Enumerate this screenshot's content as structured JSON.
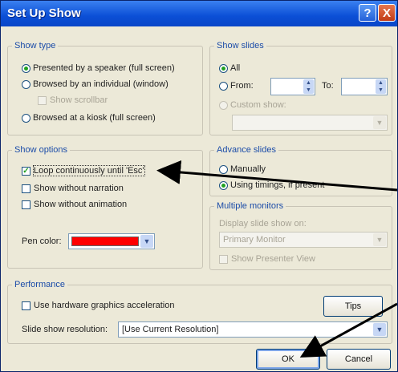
{
  "title": "Set Up Show",
  "titlebar": {
    "help": "?",
    "close": "X"
  },
  "show_type": {
    "label": "Show type",
    "options": [
      "Presented by a speaker (full screen)",
      "Browsed by an individual (window)",
      "Show scrollbar",
      "Browsed at a kiosk (full screen)"
    ],
    "selected": 0
  },
  "show_slides": {
    "label": "Show slides",
    "all": "All",
    "from": "From:",
    "to": "To:",
    "custom": "Custom show:"
  },
  "show_options": {
    "label": "Show options",
    "loop": "Loop continuously until 'Esc'",
    "loop_checked": true,
    "no_narration": "Show without narration",
    "no_animation": "Show without animation",
    "pen_color_label": "Pen color:",
    "pen_color": "#ff0000"
  },
  "advance_slides": {
    "label": "Advance slides",
    "manually": "Manually",
    "timings": "Using timings, if present",
    "selected": 1
  },
  "multiple_monitors": {
    "label": "Multiple monitors",
    "display_label": "Display slide show on:",
    "display_value": "Primary Monitor",
    "presenter_view": "Show Presenter View"
  },
  "performance": {
    "label": "Performance",
    "hw_accel": "Use hardware graphics acceleration",
    "tips": "Tips",
    "resolution_label": "Slide show resolution:",
    "resolution_value": "[Use Current Resolution]"
  },
  "buttons": {
    "ok": "OK",
    "cancel": "Cancel"
  },
  "icons": {
    "dropdown": "chevron-down-icon",
    "spin": "spin-arrows-icon",
    "annotation": "arrow-icon"
  },
  "colors": {
    "title_bar": "#0b4fd6",
    "group_label": "#1b4ca8",
    "dialog_bg": "#ece9d8"
  }
}
